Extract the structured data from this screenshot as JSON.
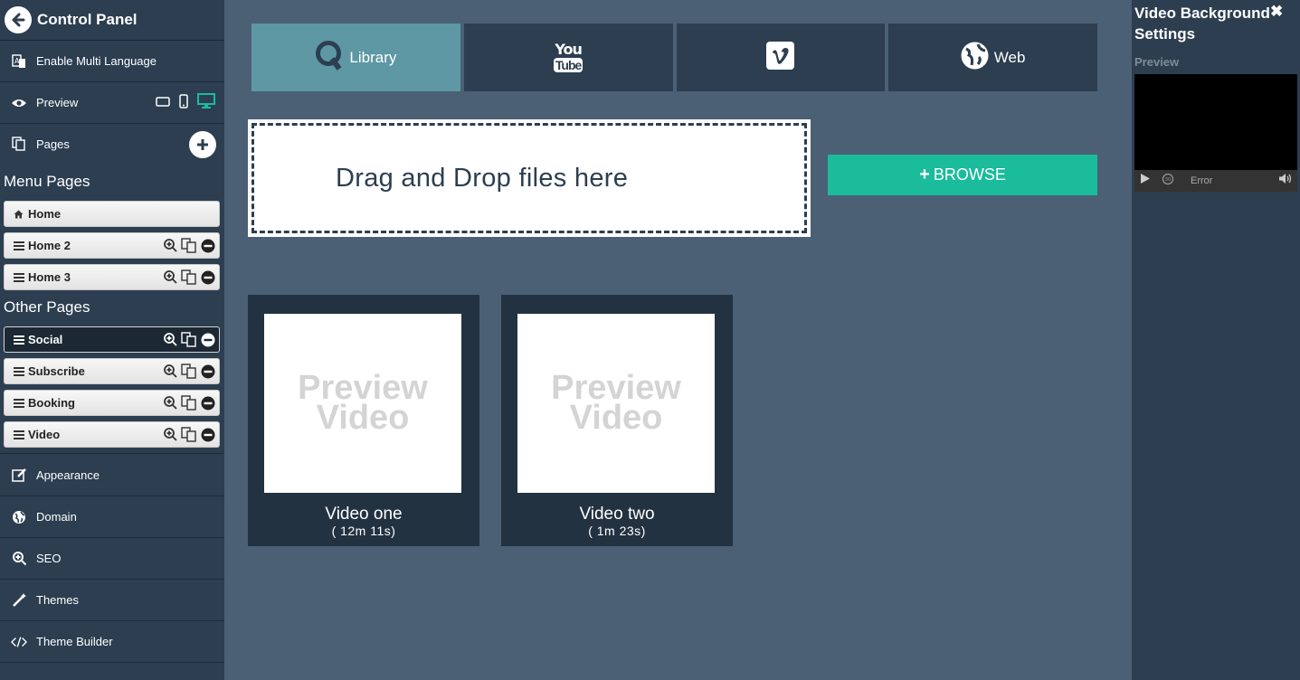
{
  "sidebar": {
    "title": "Control Panel",
    "multi_language": "Enable Multi Language",
    "preview": "Preview",
    "pages": "Pages",
    "menu_pages_title": "Menu Pages",
    "other_pages_title": "Other Pages",
    "menu_pages": [
      {
        "label": "Home"
      },
      {
        "label": "Home 2"
      },
      {
        "label": "Home 3"
      }
    ],
    "other_pages": [
      {
        "label": "Social"
      },
      {
        "label": "Subscribe"
      },
      {
        "label": "Booking"
      },
      {
        "label": "Video"
      }
    ],
    "bottom_items": [
      {
        "label": "Appearance",
        "icon": "edit-icon"
      },
      {
        "label": "Domain",
        "icon": "globe-icon"
      },
      {
        "label": "SEO",
        "icon": "search-icon"
      },
      {
        "label": "Themes",
        "icon": "magic-wand-icon"
      },
      {
        "label": "Theme Builder",
        "icon": "code-icon"
      }
    ]
  },
  "source_tabs": [
    {
      "label": "Library",
      "icon": "library-logo-icon",
      "active": true
    },
    {
      "label": "",
      "icon": "youtube-icon",
      "active": false
    },
    {
      "label": "",
      "icon": "vimeo-icon",
      "active": false
    },
    {
      "label": "Web",
      "icon": "globe-icon",
      "active": false
    }
  ],
  "youtube_text": {
    "top": "You",
    "bottom": "Tube"
  },
  "dropzone": {
    "text": "Drag and Drop files here"
  },
  "browse": {
    "label": "BROWSE"
  },
  "videos": [
    {
      "thumb_line1": "Preview",
      "thumb_line2": "Video",
      "name": "Video one",
      "duration": "( 12m 11s)"
    },
    {
      "thumb_line1": "Preview",
      "thumb_line2": "Video",
      "name": "Video two",
      "duration": "( 1m 23s)"
    }
  ],
  "right_panel": {
    "title": "Video Background Settings",
    "close": "✖",
    "preview_label": "Preview",
    "player_status": "Error"
  },
  "colors": {
    "sidebar": "#2c3e50",
    "main_bg": "#4b6075",
    "active_tab": "#5d98a4",
    "browse": "#1abc9c",
    "device_active": "#1abc9c"
  }
}
